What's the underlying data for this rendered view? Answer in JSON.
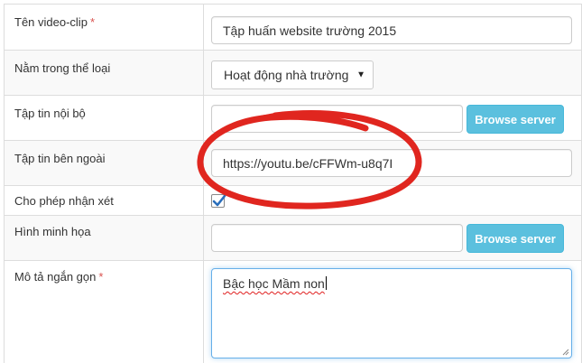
{
  "form": {
    "title_field": {
      "label": "Tên video-clip",
      "required_mark": "*",
      "value": "Tập huấn website trường 2015"
    },
    "category_field": {
      "label": "Nằm trong thể loại",
      "selected": "Hoạt động nhà trường",
      "caret": "▼"
    },
    "internal_file_field": {
      "label": "Tập tin nội bộ",
      "value": "",
      "button_label": "Browse server"
    },
    "external_file_field": {
      "label": "Tập tin bên ngoài",
      "value": "https://youtu.be/cFFWm-u8q7I"
    },
    "allow_comments_field": {
      "label": "Cho phép nhận xét",
      "checked": true
    },
    "illustration_field": {
      "label": "Hình minh họa",
      "value": "",
      "button_label": "Browse server"
    },
    "description_field": {
      "label": "Mô tả ngắn gọn",
      "required_mark": "*",
      "value": "Bậc học Mầm non"
    }
  },
  "colors": {
    "required": "#d9534f",
    "button": "#5bc0de",
    "checkbox_tick": "#2a6ebb",
    "annotation_ring": "#e0261f",
    "focus_border": "#66afe9"
  },
  "icons": {
    "checkmark": "checkmark-icon",
    "dropdown": "chevron-down-icon",
    "resize": "resize-grip-icon"
  }
}
